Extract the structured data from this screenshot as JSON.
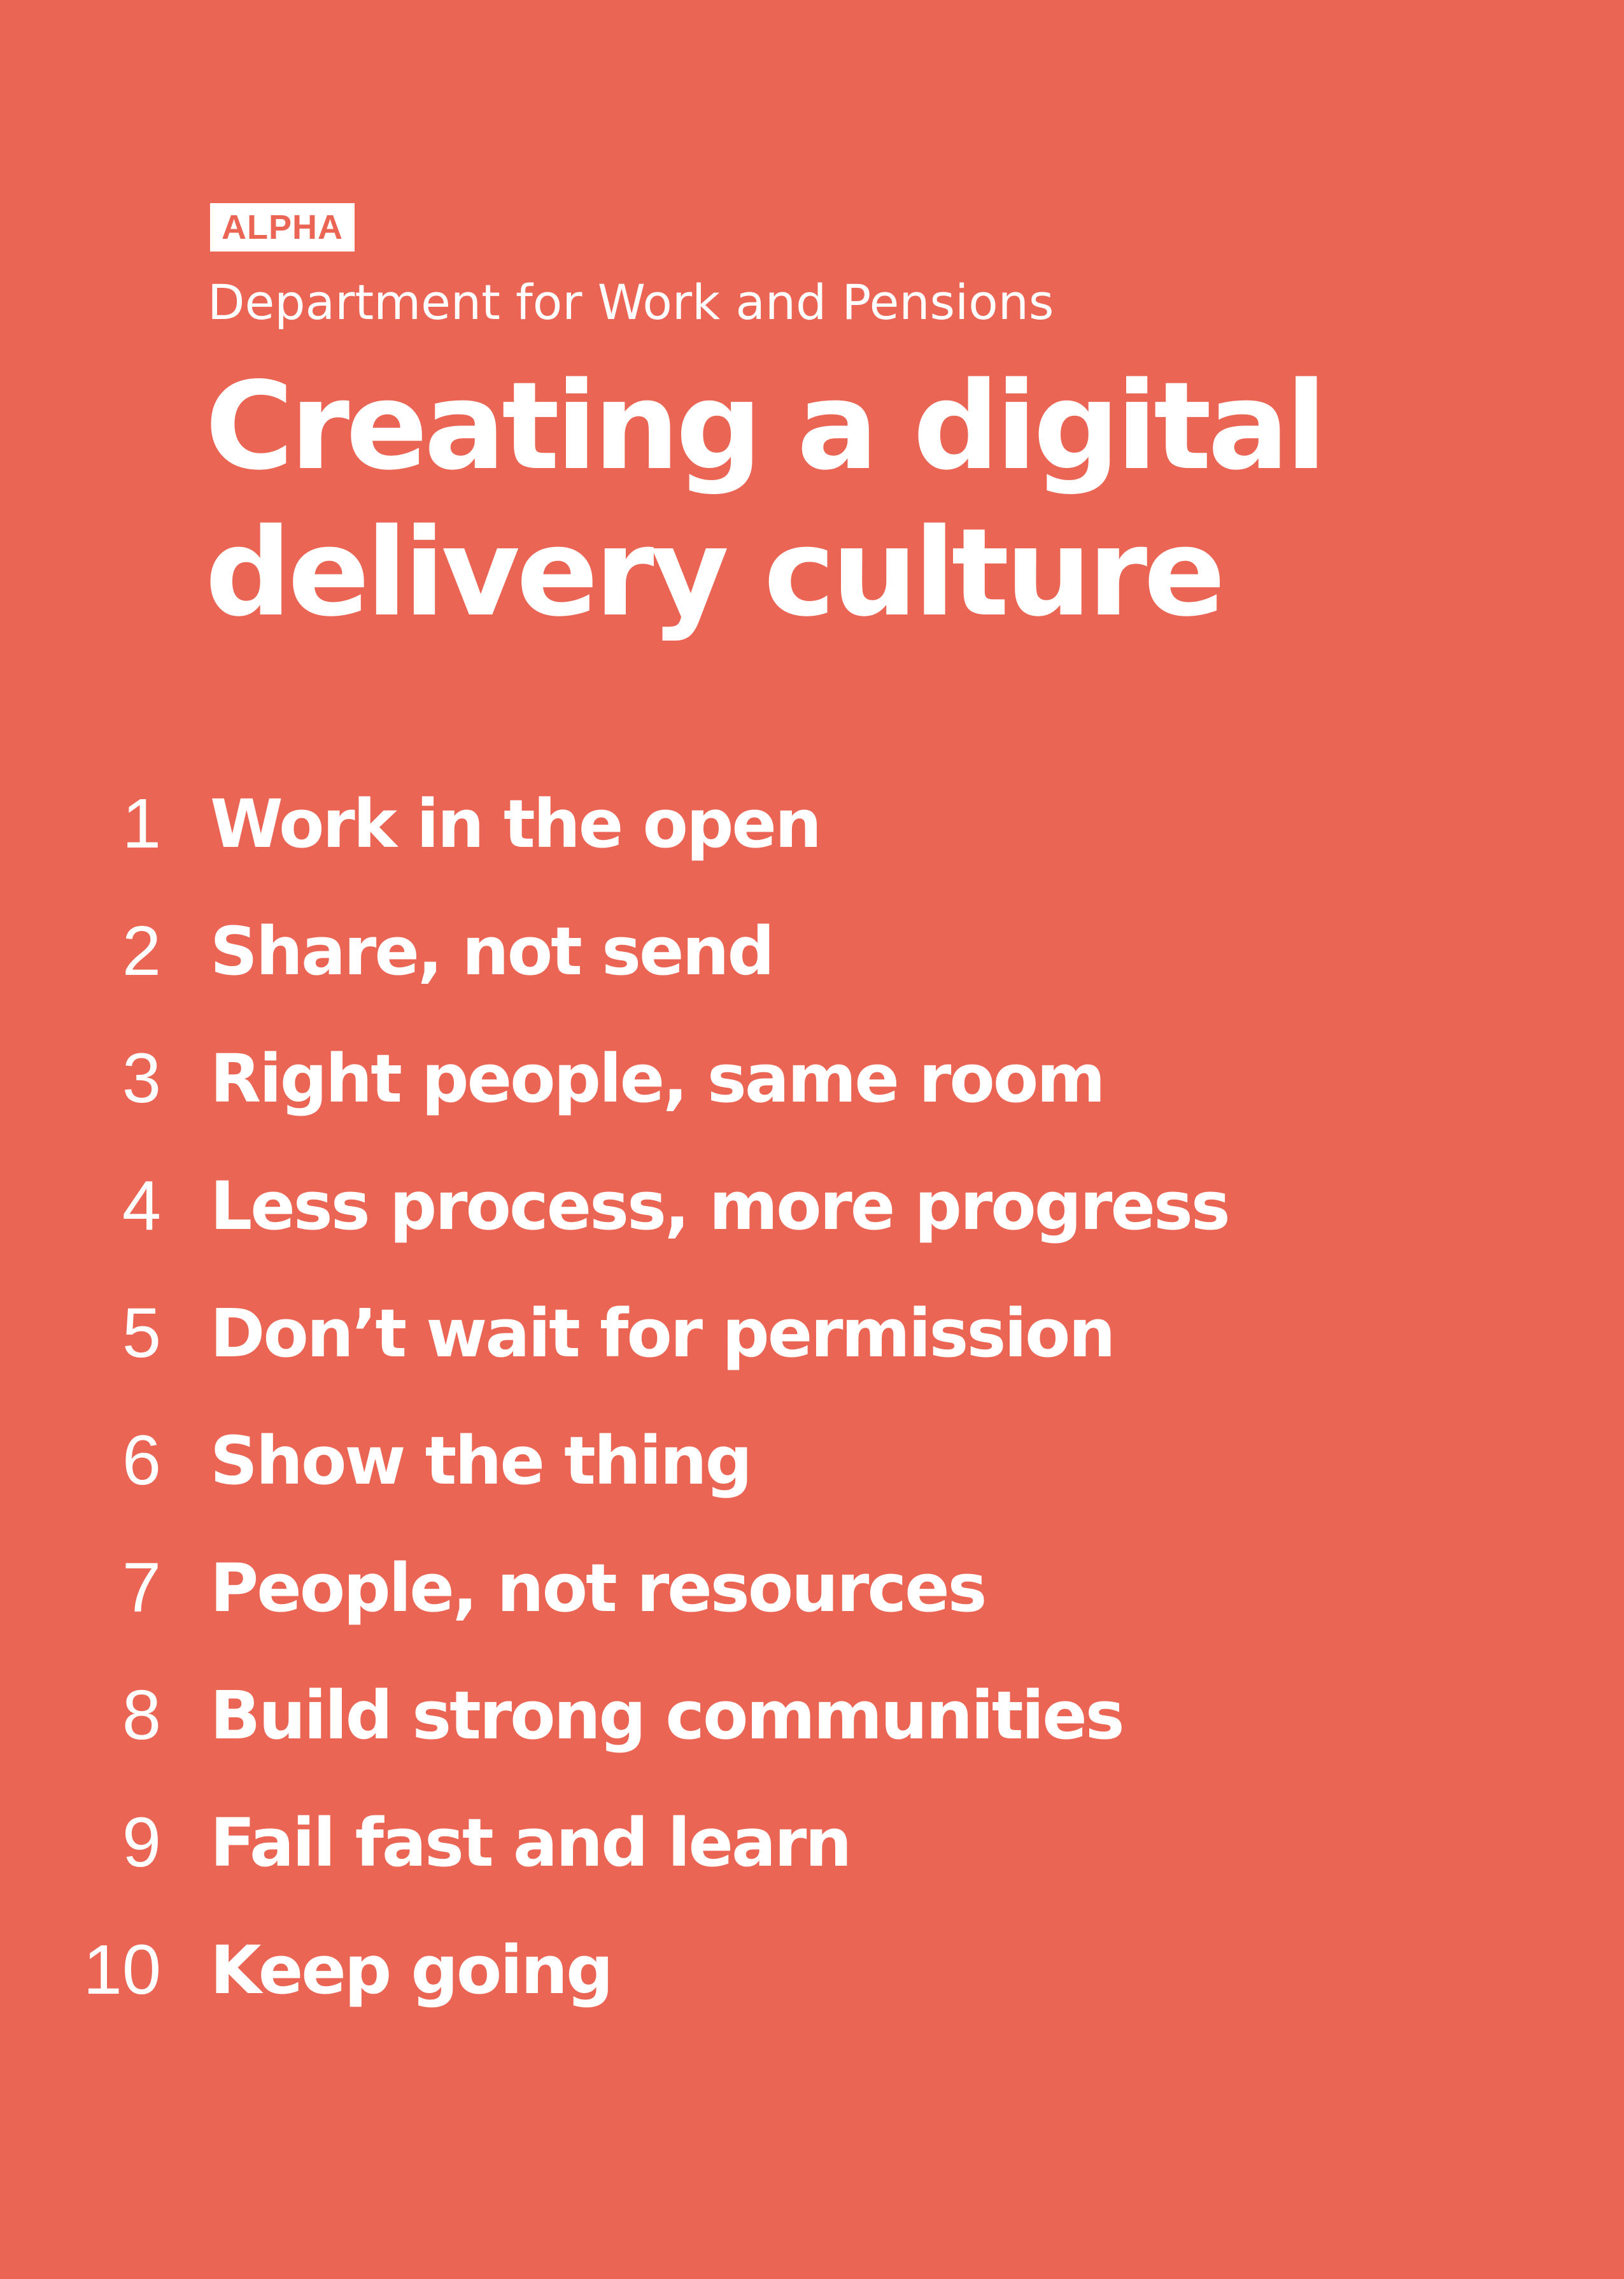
{
  "badge": "ALPHA",
  "department": "Department for Work and Pensions",
  "title": {
    "line1": "Creating a digital",
    "line2": "delivery culture"
  },
  "principles": [
    {
      "number": "1",
      "text": "Work in the open"
    },
    {
      "number": "2",
      "text": "Share, not send"
    },
    {
      "number": "3",
      "text": "Right people, same room"
    },
    {
      "number": "4",
      "text": "Less process, more progress"
    },
    {
      "number": "5",
      "text": "Don’t wait for permission"
    },
    {
      "number": "6",
      "text": "Show the thing"
    },
    {
      "number": "7",
      "text": "People, not resources"
    },
    {
      "number": "8",
      "text": "Build strong communities"
    },
    {
      "number": "9",
      "text": "Fail fast and learn"
    },
    {
      "number": "10",
      "text": "Keep going"
    }
  ],
  "colors": {
    "background": "#EB6554",
    "text": "#FFFFFF"
  }
}
